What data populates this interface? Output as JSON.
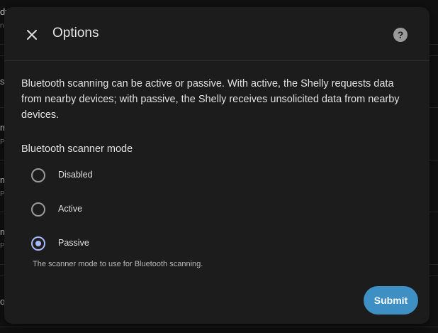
{
  "background": {
    "snippets": [
      {
        "text": "dy",
        "sub": "ni"
      },
      {
        "text": "s",
        "sub": ""
      },
      {
        "text": "m",
        "sub": "PM"
      },
      {
        "text": "m",
        "sub": "PM"
      },
      {
        "text": "m",
        "sub": "PM"
      },
      {
        "text": "o",
        "sub": ""
      }
    ]
  },
  "dialog": {
    "title": "Options",
    "close_icon": "close-icon",
    "help_icon": "help-circle-icon",
    "description": "Bluetooth scanning can be active or passive. With active, the Shelly requests data from nearby devices; with passive, the Shelly receives unsolicited data from nearby devices.",
    "field_label": "Bluetooth scanner mode",
    "options": [
      {
        "label": "Disabled",
        "checked": false
      },
      {
        "label": "Active",
        "checked": false
      },
      {
        "label": "Passive",
        "checked": true
      }
    ],
    "helper_text": "The scanner mode to use for Bluetooth scanning.",
    "submit_label": "Submit"
  },
  "colors": {
    "accent": "#3d8fc4",
    "radio_selected": "#a8b8ff",
    "surface": "#1c1c1c",
    "background": "#111111"
  }
}
